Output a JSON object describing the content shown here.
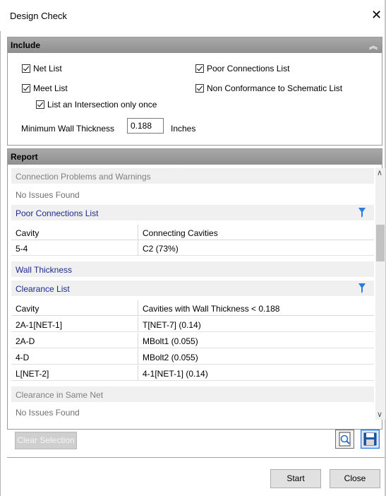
{
  "window": {
    "title": "Design Check",
    "close_glyph": "✕"
  },
  "include": {
    "header": "Include",
    "net_list": "Net List",
    "meet_list": "Meet List",
    "intersection_once": "List an Intersection only once",
    "poor_connections_list": "Poor Connections List",
    "non_conformance_list": "Non Conformance to Schematic List",
    "min_wall_label": "Minimum Wall Thickness",
    "min_wall_value": "0.188",
    "min_wall_unit": "Inches"
  },
  "report": {
    "header": "Report",
    "connection_problems": "Connection Problems and Warnings",
    "no_issues_1": "No Issues Found",
    "poor_connections": {
      "title": "Poor Connections List",
      "col1": "Cavity",
      "col2": "Connecting Cavities",
      "rows": [
        {
          "c1": "5-4",
          "c2": "C2 (73%)"
        }
      ]
    },
    "wall_thickness": "Wall Thickness",
    "clearance": {
      "title": "Clearance List",
      "col1": "Cavity",
      "col2": "Cavities with Wall Thickness < 0.188",
      "rows": [
        {
          "c1": "2A-1[NET-1]",
          "c2": "T[NET-7] (0.14)"
        },
        {
          "c1": "2A-D",
          "c2": "MBolt1 (0.055)"
        },
        {
          "c1": "4-D",
          "c2": "MBolt2 (0.055)"
        },
        {
          "c1": "L[NET-2]",
          "c2": "4-1[NET-1] (0.14)"
        }
      ]
    },
    "clearance_same_net": "Clearance in Same Net",
    "no_issues_2": "No Issues Found"
  },
  "buttons": {
    "clear_selection": "Clear Selection",
    "start": "Start",
    "close": "Close"
  },
  "icons": {
    "filter": "filter-icon",
    "preview": "print-preview-icon",
    "save": "save-icon",
    "collapse": "collapse-chevrons-icon"
  },
  "colors": {
    "link_blue": "#1f2a8a",
    "filter_blue": "#2a7be4",
    "header_gray": "#9a9a9a"
  }
}
